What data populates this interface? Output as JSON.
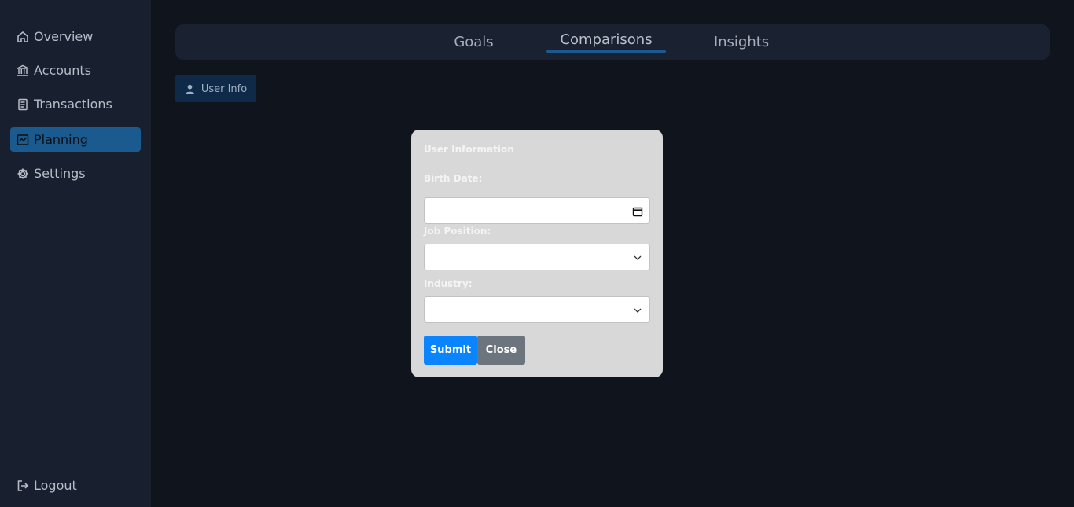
{
  "sidebar": {
    "items": [
      {
        "label": "Overview",
        "icon": "home-icon"
      },
      {
        "label": "Accounts",
        "icon": "bank-icon"
      },
      {
        "label": "Transactions",
        "icon": "receipt-icon"
      },
      {
        "label": "Planning",
        "icon": "chart-icon",
        "active": true
      },
      {
        "label": "Settings",
        "icon": "gear-icon"
      }
    ],
    "logout": "Logout"
  },
  "tabs": [
    {
      "label": "Goals"
    },
    {
      "label": "Comparisons",
      "active": true
    },
    {
      "label": "Insights"
    }
  ],
  "user_info_button": "User Info",
  "modal": {
    "title": "User Information",
    "birth_date_label": "Birth Date:",
    "job_position_label": "Job Position:",
    "industry_label": "Industry:",
    "submit": "Submit",
    "close": "Close"
  },
  "colors": {
    "accent": "#1b5a8f",
    "submit": "#0a84ff",
    "close": "#6c747d"
  }
}
